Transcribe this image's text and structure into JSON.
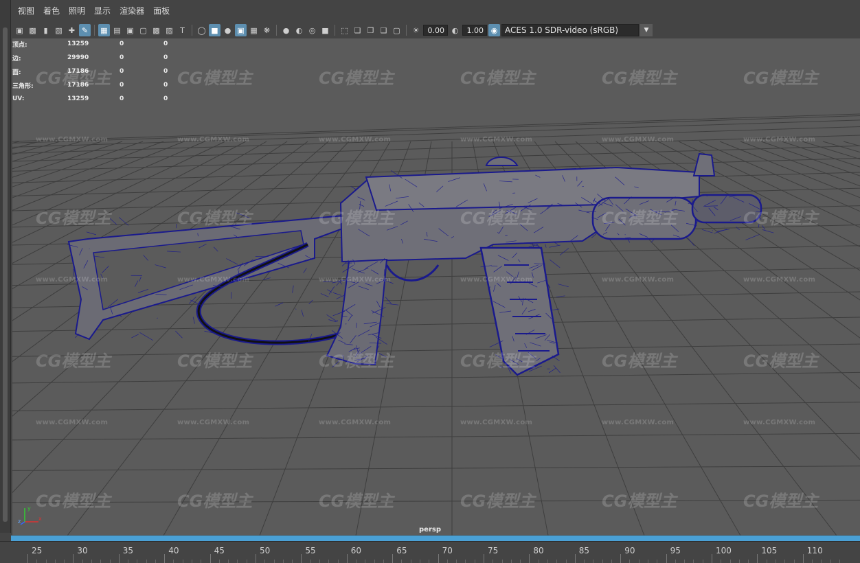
{
  "menu": [
    "视图",
    "着色",
    "照明",
    "显示",
    "渲染器",
    "面板"
  ],
  "toolbar": {
    "icons": [
      "camera-icon",
      "camera-attributes-icon",
      "bookmark-icon",
      "image-plane-icon",
      "2d-pan-zoom-icon",
      "grease-pencil-icon",
      "grid-icon",
      "film-gate-icon",
      "resolution-gate-icon",
      "gate-mask-icon",
      "field-chart-icon",
      "safe-action-icon",
      "safe-title-icon",
      "wireframe-icon",
      "smooth-shade-icon",
      "default-material-icon",
      "textured-icon",
      "use-all-lights-icon",
      "shadows-icon",
      "screen-space-ao-icon",
      "motion-blur-icon",
      "multisample-aa-icon",
      "depth-of-field-icon",
      "isolate-select-icon",
      "xray-icon",
      "xray-active-components-icon",
      "xray-joints-icon",
      "backface-culling-icon",
      "exposure-icon",
      "gamma-icon",
      "color-management-icon"
    ],
    "exposure": "0.00",
    "gamma": "1.00",
    "color_space": "ACES 1.0 SDR-video (sRGB)"
  },
  "hud": {
    "rows": [
      {
        "label": "顶点:",
        "v1": "13259",
        "v2": "0",
        "v3": "0"
      },
      {
        "label": "边:",
        "v1": "29990",
        "v2": "0",
        "v3": "0"
      },
      {
        "label": "面:",
        "v1": "17186",
        "v2": "0",
        "v3": "0"
      },
      {
        "label": "三角形:",
        "v1": "17186",
        "v2": "0",
        "v3": "0"
      },
      {
        "label": "UV:",
        "v1": "13259",
        "v2": "0",
        "v3": "0"
      }
    ]
  },
  "watermark": {
    "brand": "CG模型主",
    "url": "www.CGMXW.com"
  },
  "axis": {
    "x": "x",
    "y": "y",
    "z": "z"
  },
  "camera_label": "persp",
  "timeline": {
    "labels": [
      "25",
      "30",
      "35",
      "40",
      "45",
      "50",
      "55",
      "60",
      "65",
      "70",
      "75",
      "80",
      "85",
      "90",
      "95",
      "100",
      "105",
      "110"
    ]
  },
  "colors": {
    "wireframe": "#1a1a8c",
    "model_fill": "#5c5c6a",
    "timeline_accent": "#4aa0d5",
    "active_tool": "#5d8fb0"
  }
}
